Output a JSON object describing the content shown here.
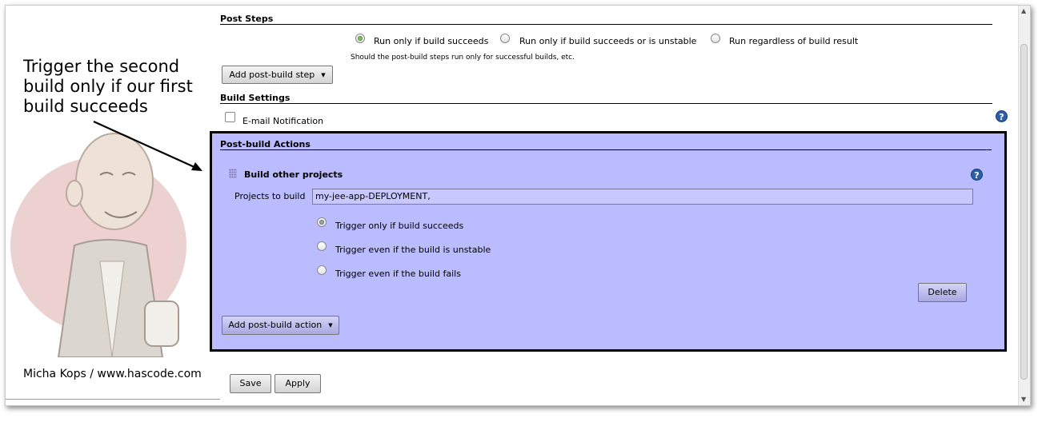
{
  "annotation": {
    "text": "Trigger the second build only if our first build succeeds",
    "credit": "Micha Kops / www.hascode.com"
  },
  "post_steps": {
    "heading": "Post Steps",
    "options": [
      {
        "label": "Run only if build succeeds",
        "selected": true
      },
      {
        "label": "Run only if build succeeds or is unstable",
        "selected": false
      },
      {
        "label": "Run regardless of build result",
        "selected": false
      }
    ],
    "hint": "Should the post-build steps run only for successful builds, etc.",
    "add_button": "Add post-build step"
  },
  "build_settings": {
    "heading": "Build Settings",
    "email_label": "E-mail Notification",
    "email_checked": false,
    "help_icon": "help-icon"
  },
  "post_build": {
    "heading": "Post-build Actions",
    "highlight_color": "#bbbbff",
    "action_title": "Build other projects",
    "projects_label": "Projects to build",
    "projects_value": "my-jee-app-DEPLOYMENT,",
    "triggers": [
      {
        "label": "Trigger only if build succeeds",
        "selected": true
      },
      {
        "label": "Trigger even if the build is unstable",
        "selected": false
      },
      {
        "label": "Trigger even if the build fails",
        "selected": false
      }
    ],
    "delete_button": "Delete",
    "add_button": "Add post-build action"
  },
  "footer": {
    "save_button": "Save",
    "apply_button": "Apply"
  },
  "icons": [
    "help-icon",
    "drag-handle-icon",
    "dropdown-arrow-icon",
    "jenkins-mascot-icon",
    "annotation-arrow-icon"
  ]
}
